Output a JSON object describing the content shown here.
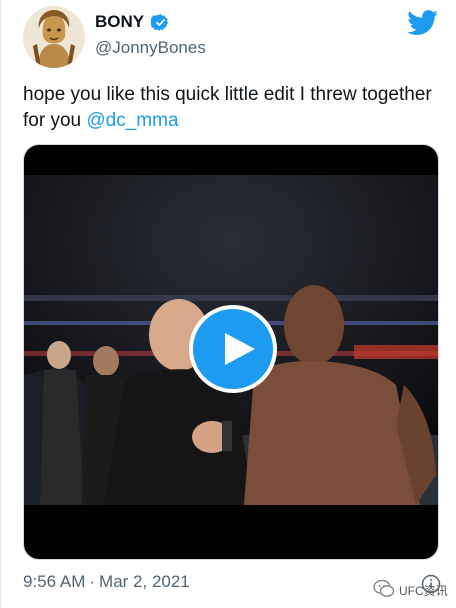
{
  "tweet": {
    "author": {
      "display_name": "BONY",
      "handle": "@JonnyBones",
      "verified": true
    },
    "text": "hope you like this quick little edit I threw together for you",
    "mention": "@dc_mma",
    "time": "9:56 AM",
    "date": "Mar 2, 2021"
  },
  "media": {
    "type": "video",
    "play_icon": "play-icon"
  },
  "watermark": {
    "text": "UFC资讯"
  },
  "icons": {
    "brand": "twitter-bird-icon",
    "verified": "verified-badge-icon",
    "info": "info-icon"
  },
  "colors": {
    "accent": "#1d9bf0",
    "text": "#0f1419",
    "secondary": "#536471"
  }
}
